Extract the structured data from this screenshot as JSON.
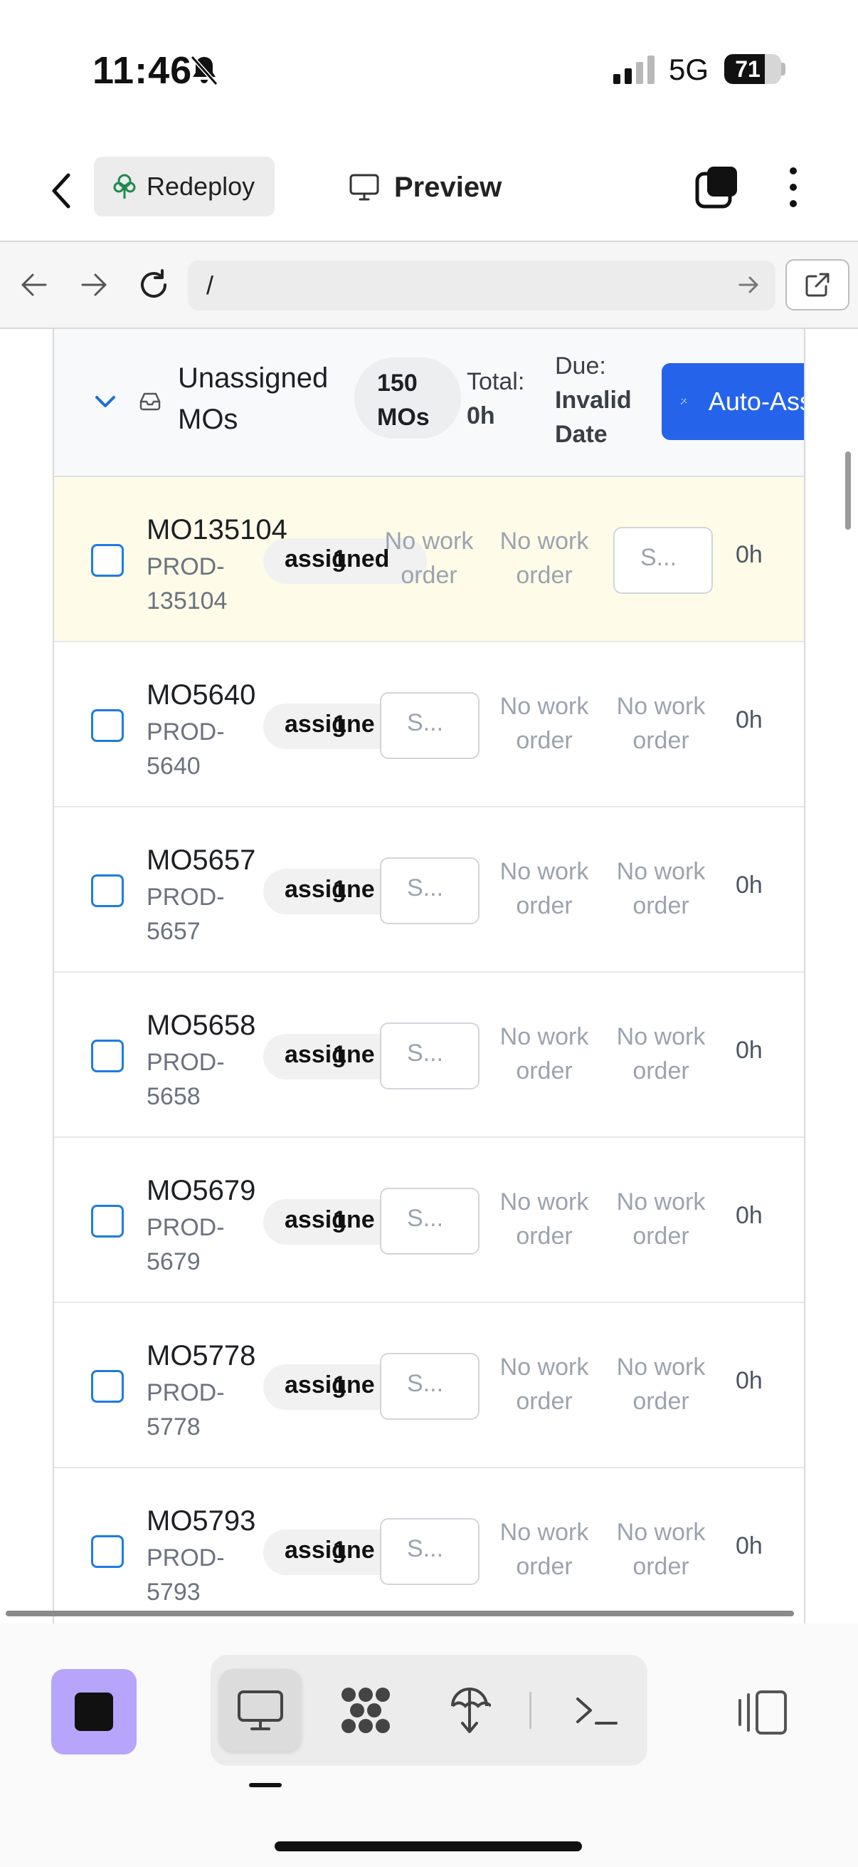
{
  "status_bar": {
    "time": "11:46",
    "network": "5G",
    "battery": "71",
    "battery_level": 0.71
  },
  "header": {
    "redeploy_label": "Redeploy",
    "preview_label": "Preview"
  },
  "browser": {
    "url": "/"
  },
  "group": {
    "title": "Unassigned MOs",
    "count": "150 MOs",
    "total_label": "Total:",
    "total_value": "0h",
    "due_label": "Due:",
    "due_value": "Invalid Date",
    "auto_button": "Auto-Assign"
  },
  "rows": [
    {
      "id": "MO135104",
      "prod": "PROD-135104",
      "status": "assigned",
      "status_num": "1",
      "col_a": "No work order",
      "col_b": "No work order",
      "select": "S...",
      "hours": "0h"
    },
    {
      "id": "MO5640",
      "prod": "PROD-5640",
      "status": "assigne",
      "status_num": "1",
      "select": "S...",
      "col_b": "No work order",
      "col_c": "No work order",
      "hours": "0h"
    },
    {
      "id": "MO5657",
      "prod": "PROD-5657",
      "status": "assigne",
      "status_num": "1",
      "select": "S...",
      "col_b": "No work order",
      "col_c": "No work order",
      "hours": "0h"
    },
    {
      "id": "MO5658",
      "prod": "PROD-5658",
      "status": "assigne",
      "status_num": "1",
      "select": "S...",
      "col_b": "No work order",
      "col_c": "No work order",
      "hours": "0h"
    },
    {
      "id": "MO5679",
      "prod": "PROD-5679",
      "status": "assigne",
      "status_num": "1",
      "select": "S...",
      "col_b": "No work order",
      "col_c": "No work order",
      "hours": "0h"
    },
    {
      "id": "MO5778",
      "prod": "PROD-5778",
      "status": "assigne",
      "status_num": "1",
      "select": "S...",
      "col_b": "No work order",
      "col_c": "No work order",
      "hours": "0h"
    },
    {
      "id": "MO5793",
      "prod": "PROD-5793",
      "status": "assigne",
      "status_num": "1",
      "select": "S...",
      "col_b": "No work order",
      "col_c": "No work order",
      "hours": "0h"
    }
  ],
  "icons": {
    "bell": "bell-slash-icon",
    "signal": "signal-icon",
    "back": "chevron-left-icon",
    "redeploy": "tree-icon",
    "preview": "monitor-icon",
    "tabs": "tabs-icon",
    "more": "more-vertical-icon",
    "nav_back": "arrow-left-icon",
    "nav_forward": "arrow-right-icon",
    "reload": "reload-icon",
    "go": "arrow-right-icon",
    "external": "external-link-icon",
    "chevron": "chevron-down-icon",
    "inbox": "inbox-icon",
    "wand": "magic-wand-icon",
    "desktop": "desktop-icon",
    "flow": "workflow-icon",
    "deploy": "deploy-icon",
    "terminal": "terminal-icon",
    "sidebar": "sidebar-toggle-icon"
  },
  "colors": {
    "accent": "#2563eb",
    "highlight_row": "#fefce8",
    "checkbox": "#1e7ce0",
    "app_icon": "#b7a4fb"
  }
}
